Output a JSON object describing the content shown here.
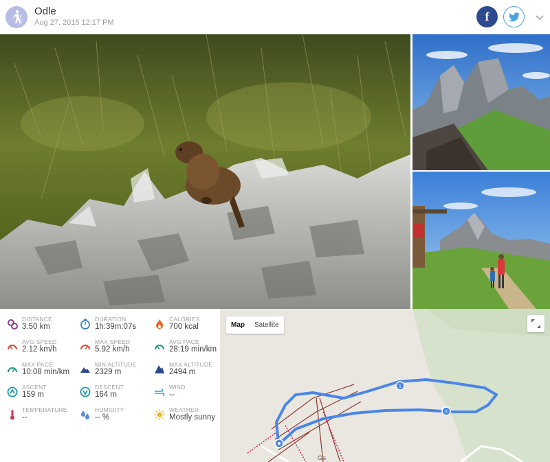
{
  "header": {
    "title": "Odle",
    "date": "Aug 27, 2015 12:17 PM",
    "facebook_glyph": "f",
    "avatar_icon": "hiker-icon"
  },
  "stats": [
    {
      "label": "DISTANCE",
      "value": "3.50 km",
      "icon": "distance-icon",
      "color": "#8e3d8c"
    },
    {
      "label": "DURATION",
      "value": "1h:39m:07s",
      "icon": "stopwatch-icon",
      "color": "#3a86c8"
    },
    {
      "label": "CALORIES",
      "value": "700 kcal",
      "icon": "flame-icon",
      "color": "#e8672a"
    },
    {
      "label": "AVG SPEED",
      "value": "2.12 km/h",
      "icon": "avg-speed-gauge-icon",
      "color": "#e4472e"
    },
    {
      "label": "MAX SPEED",
      "value": "5.92 km/h",
      "icon": "max-speed-gauge-icon",
      "color": "#e4472e"
    },
    {
      "label": "AVG PACE",
      "value": "28:19 min/km",
      "icon": "avg-pace-gauge-icon",
      "color": "#1e9a7b"
    },
    {
      "label": "MAX PACE",
      "value": "10:08 min/km",
      "icon": "max-pace-gauge-icon",
      "color": "#1e9a7b"
    },
    {
      "label": "MIN ALTITUDE",
      "value": "2329 m",
      "icon": "min-altitude-mountain-icon",
      "color": "#2c4a8f"
    },
    {
      "label": "MAX ALTITUDE",
      "value": "2494 m",
      "icon": "max-altitude-mountain-icon",
      "color": "#2c4a8f"
    },
    {
      "label": "ASCENT",
      "value": "159 m",
      "icon": "ascent-icon",
      "color": "#1b9aaa"
    },
    {
      "label": "DESCENT",
      "value": "164 m",
      "icon": "descent-icon",
      "color": "#1b9aaa"
    },
    {
      "label": "WIND",
      "value": "--",
      "icon": "wind-icon",
      "color": "#2a9fd6"
    },
    {
      "label": "TEMPERATURE",
      "value": "--",
      "icon": "thermometer-icon",
      "color": "#c33a5a"
    },
    {
      "label": "HUMIDITY",
      "value": "-- %",
      "icon": "humidity-drops-icon",
      "color": "#5b8fd6"
    },
    {
      "label": "WEATHER",
      "value": "Mostly sunny",
      "icon": "sun-icon",
      "color": "#f0b41c"
    }
  ],
  "map": {
    "tabs": [
      "Map",
      "Satellite"
    ],
    "active_tab": "Map",
    "route_color": "#4a86e8",
    "markers": [
      "1",
      "2"
    ],
    "street_label": "Ga"
  }
}
